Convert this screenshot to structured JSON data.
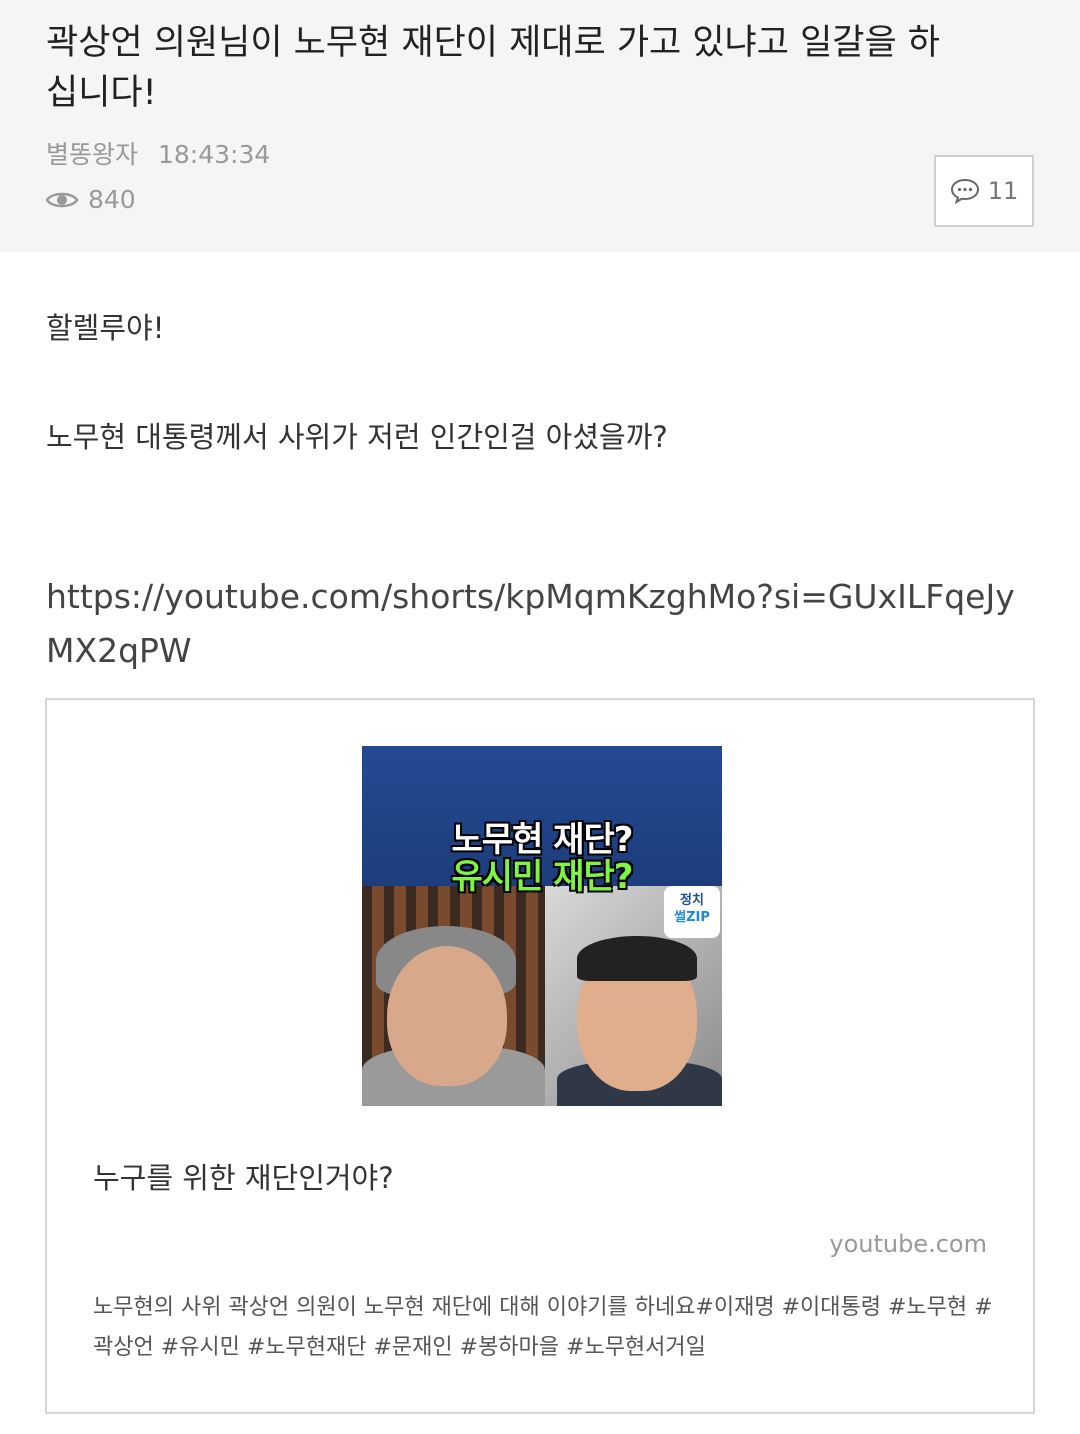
{
  "post": {
    "title": "곽상언 의원님이 노무현 재단이 제대로 가고 있냐고 일갈을 하십니다!",
    "author": "별똥왕자",
    "time": "18:43:34",
    "views": "840",
    "comments": "11"
  },
  "content": {
    "line1": "할렐루야!",
    "line2": "노무현 대통령께서 사위가 저런 인간인걸 아셨을까?",
    "link": "https://youtube.com/shorts/kpMqmKzghMo?si=GUxILFqeJyMX2qPW"
  },
  "embed": {
    "thumb_line1": "노무현 재단?",
    "thumb_line2": "유시민 재단?",
    "badge_line1": "정치",
    "badge_line2": "썰ZIP",
    "title": "누구를 위한 재단인거야?",
    "domain": "youtube.com",
    "description": "노무현의 사위 곽상언 의원이 노무현 재단에 대해 이야기를 하네요#이재명 #이대통령 #노무현 #곽상언 #유시민 #노무현재단 #문재인 #봉하마을 #노무현서거일"
  }
}
